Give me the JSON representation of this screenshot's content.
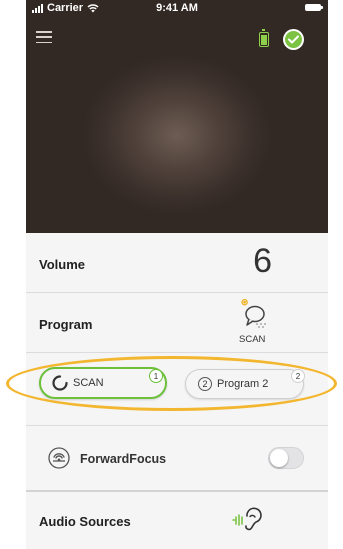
{
  "status_bar": {
    "carrier": "Carrier",
    "time": "9:41 AM"
  },
  "header": {
    "menu_icon": "hamburger-menu-icon",
    "battery_icon": "battery-full-icon",
    "connected_icon": "checkmark-circle-icon"
  },
  "volume": {
    "label": "Volume",
    "value": "6"
  },
  "program": {
    "label": "Program",
    "current": "SCAN",
    "icon": "scan-program-icon"
  },
  "program_selector": {
    "options": [
      {
        "label": "SCAN",
        "badge": "1",
        "selected": true
      },
      {
        "label": "Program 2",
        "number": "2",
        "badge": "2",
        "selected": false
      }
    ]
  },
  "forward_focus": {
    "label": "ForwardFocus",
    "enabled": false
  },
  "audio_sources": {
    "label": "Audio Sources",
    "icon": "hearing-stream-icon"
  },
  "colors": {
    "accent_green": "#6cc03a",
    "highlight_ring": "#f3b62f",
    "header_dark": "#3a2f2a"
  }
}
